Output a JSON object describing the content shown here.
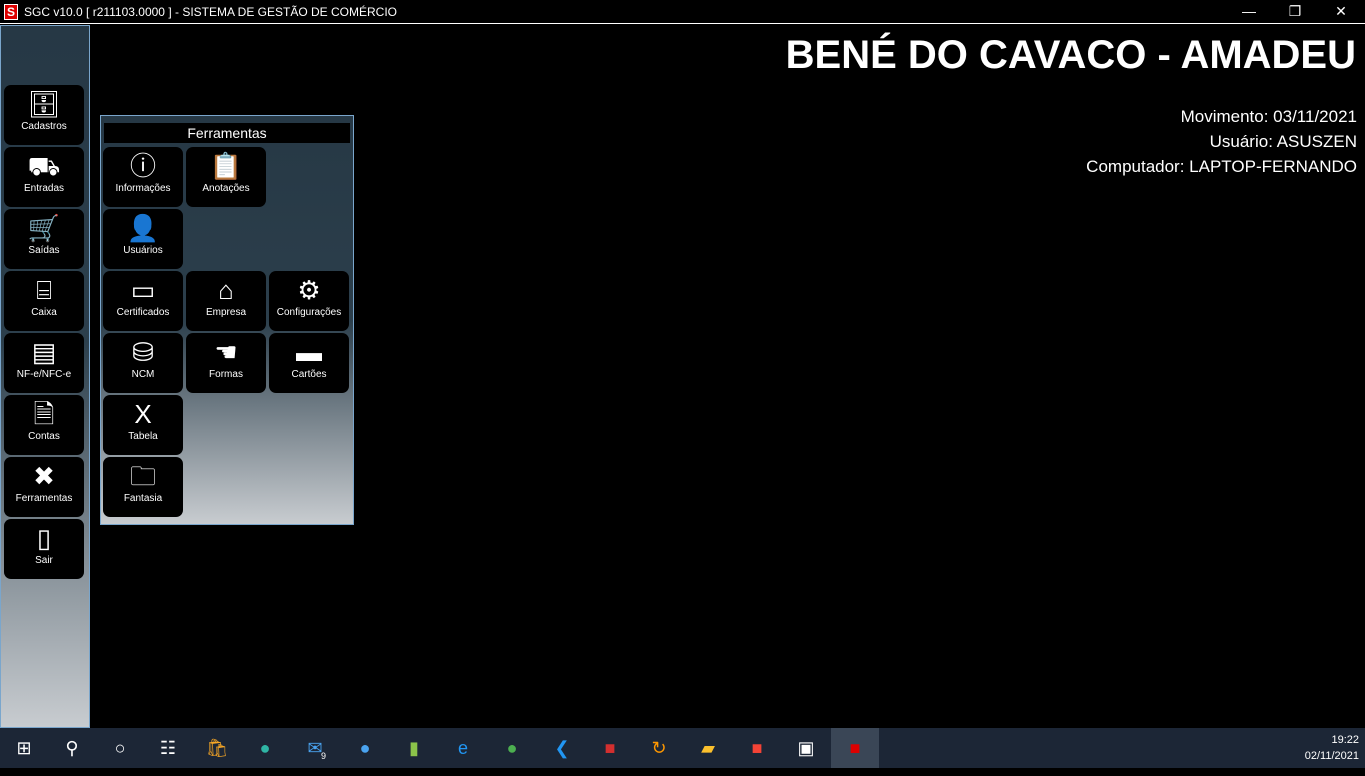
{
  "window": {
    "title": "SGC v10.0 [ r211103.0000 ] - SISTEMA DE GESTÃO DE COMÉRCIO",
    "logo": "S"
  },
  "header": {
    "company": "BENÉ DO CAVACO - AMADEU",
    "movimento": "Movimento: 03/11/2021",
    "usuario": "Usuário: ASUSZEN",
    "computador": "Computador: LAPTOP-FERNANDO"
  },
  "sidebar": {
    "items": [
      {
        "label": "Cadastros",
        "icon": "cabinet-icon"
      },
      {
        "label": "Entradas",
        "icon": "truck-icon"
      },
      {
        "label": "Saídas",
        "icon": "cart-icon"
      },
      {
        "label": "Caixa",
        "icon": "cash-register-icon"
      },
      {
        "label": "NF-e/NFC-e",
        "icon": "invoice-icon"
      },
      {
        "label": "Contas",
        "icon": "document-icon"
      },
      {
        "label": "Ferramentas",
        "icon": "tools-icon"
      },
      {
        "label": "Sair",
        "icon": "door-icon"
      }
    ]
  },
  "panel": {
    "title": "Ferramentas",
    "items": [
      {
        "label": "Informações",
        "icon": "info-icon"
      },
      {
        "label": "Anotações",
        "icon": "clipboard-icon"
      },
      {
        "label": "Usuários",
        "icon": "add-user-icon"
      },
      {
        "label": "Certificados",
        "icon": "certificate-icon"
      },
      {
        "label": "Empresa",
        "icon": "house-icon"
      },
      {
        "label": "Configurações",
        "icon": "gear-icon"
      },
      {
        "label": "NCM",
        "icon": "database-gear-icon"
      },
      {
        "label": "Formas",
        "icon": "payment-hand-icon"
      },
      {
        "label": "Cartões",
        "icon": "cards-icon"
      },
      {
        "label": "Tabela",
        "icon": "excel-icon"
      },
      {
        "label": "Fantasia",
        "icon": "folder-user-icon"
      }
    ]
  },
  "taskbar": {
    "time": "19:22",
    "date": "02/11/2021",
    "mail_badge": "9"
  }
}
